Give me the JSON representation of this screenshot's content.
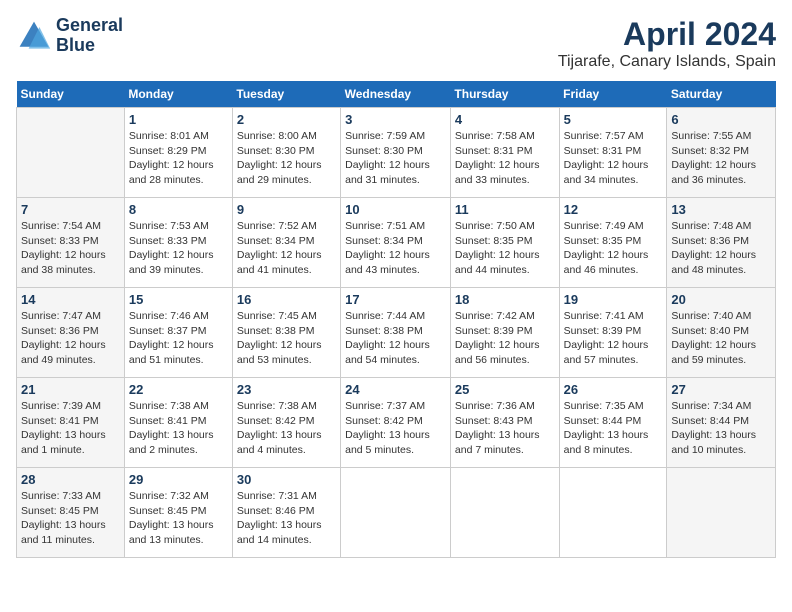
{
  "header": {
    "logo_line1": "General",
    "logo_line2": "Blue",
    "month": "April 2024",
    "location": "Tijarafe, Canary Islands, Spain"
  },
  "weekdays": [
    "Sunday",
    "Monday",
    "Tuesday",
    "Wednesday",
    "Thursday",
    "Friday",
    "Saturday"
  ],
  "weeks": [
    [
      {
        "day": "",
        "info": ""
      },
      {
        "day": "1",
        "info": "Sunrise: 8:01 AM\nSunset: 8:29 PM\nDaylight: 12 hours\nand 28 minutes."
      },
      {
        "day": "2",
        "info": "Sunrise: 8:00 AM\nSunset: 8:30 PM\nDaylight: 12 hours\nand 29 minutes."
      },
      {
        "day": "3",
        "info": "Sunrise: 7:59 AM\nSunset: 8:30 PM\nDaylight: 12 hours\nand 31 minutes."
      },
      {
        "day": "4",
        "info": "Sunrise: 7:58 AM\nSunset: 8:31 PM\nDaylight: 12 hours\nand 33 minutes."
      },
      {
        "day": "5",
        "info": "Sunrise: 7:57 AM\nSunset: 8:31 PM\nDaylight: 12 hours\nand 34 minutes."
      },
      {
        "day": "6",
        "info": "Sunrise: 7:55 AM\nSunset: 8:32 PM\nDaylight: 12 hours\nand 36 minutes."
      }
    ],
    [
      {
        "day": "7",
        "info": "Sunrise: 7:54 AM\nSunset: 8:33 PM\nDaylight: 12 hours\nand 38 minutes."
      },
      {
        "day": "8",
        "info": "Sunrise: 7:53 AM\nSunset: 8:33 PM\nDaylight: 12 hours\nand 39 minutes."
      },
      {
        "day": "9",
        "info": "Sunrise: 7:52 AM\nSunset: 8:34 PM\nDaylight: 12 hours\nand 41 minutes."
      },
      {
        "day": "10",
        "info": "Sunrise: 7:51 AM\nSunset: 8:34 PM\nDaylight: 12 hours\nand 43 minutes."
      },
      {
        "day": "11",
        "info": "Sunrise: 7:50 AM\nSunset: 8:35 PM\nDaylight: 12 hours\nand 44 minutes."
      },
      {
        "day": "12",
        "info": "Sunrise: 7:49 AM\nSunset: 8:35 PM\nDaylight: 12 hours\nand 46 minutes."
      },
      {
        "day": "13",
        "info": "Sunrise: 7:48 AM\nSunset: 8:36 PM\nDaylight: 12 hours\nand 48 minutes."
      }
    ],
    [
      {
        "day": "14",
        "info": "Sunrise: 7:47 AM\nSunset: 8:36 PM\nDaylight: 12 hours\nand 49 minutes."
      },
      {
        "day": "15",
        "info": "Sunrise: 7:46 AM\nSunset: 8:37 PM\nDaylight: 12 hours\nand 51 minutes."
      },
      {
        "day": "16",
        "info": "Sunrise: 7:45 AM\nSunset: 8:38 PM\nDaylight: 12 hours\nand 53 minutes."
      },
      {
        "day": "17",
        "info": "Sunrise: 7:44 AM\nSunset: 8:38 PM\nDaylight: 12 hours\nand 54 minutes."
      },
      {
        "day": "18",
        "info": "Sunrise: 7:42 AM\nSunset: 8:39 PM\nDaylight: 12 hours\nand 56 minutes."
      },
      {
        "day": "19",
        "info": "Sunrise: 7:41 AM\nSunset: 8:39 PM\nDaylight: 12 hours\nand 57 minutes."
      },
      {
        "day": "20",
        "info": "Sunrise: 7:40 AM\nSunset: 8:40 PM\nDaylight: 12 hours\nand 59 minutes."
      }
    ],
    [
      {
        "day": "21",
        "info": "Sunrise: 7:39 AM\nSunset: 8:41 PM\nDaylight: 13 hours\nand 1 minute."
      },
      {
        "day": "22",
        "info": "Sunrise: 7:38 AM\nSunset: 8:41 PM\nDaylight: 13 hours\nand 2 minutes."
      },
      {
        "day": "23",
        "info": "Sunrise: 7:38 AM\nSunset: 8:42 PM\nDaylight: 13 hours\nand 4 minutes."
      },
      {
        "day": "24",
        "info": "Sunrise: 7:37 AM\nSunset: 8:42 PM\nDaylight: 13 hours\nand 5 minutes."
      },
      {
        "day": "25",
        "info": "Sunrise: 7:36 AM\nSunset: 8:43 PM\nDaylight: 13 hours\nand 7 minutes."
      },
      {
        "day": "26",
        "info": "Sunrise: 7:35 AM\nSunset: 8:44 PM\nDaylight: 13 hours\nand 8 minutes."
      },
      {
        "day": "27",
        "info": "Sunrise: 7:34 AM\nSunset: 8:44 PM\nDaylight: 13 hours\nand 10 minutes."
      }
    ],
    [
      {
        "day": "28",
        "info": "Sunrise: 7:33 AM\nSunset: 8:45 PM\nDaylight: 13 hours\nand 11 minutes."
      },
      {
        "day": "29",
        "info": "Sunrise: 7:32 AM\nSunset: 8:45 PM\nDaylight: 13 hours\nand 13 minutes."
      },
      {
        "day": "30",
        "info": "Sunrise: 7:31 AM\nSunset: 8:46 PM\nDaylight: 13 hours\nand 14 minutes."
      },
      {
        "day": "",
        "info": ""
      },
      {
        "day": "",
        "info": ""
      },
      {
        "day": "",
        "info": ""
      },
      {
        "day": "",
        "info": ""
      }
    ]
  ]
}
